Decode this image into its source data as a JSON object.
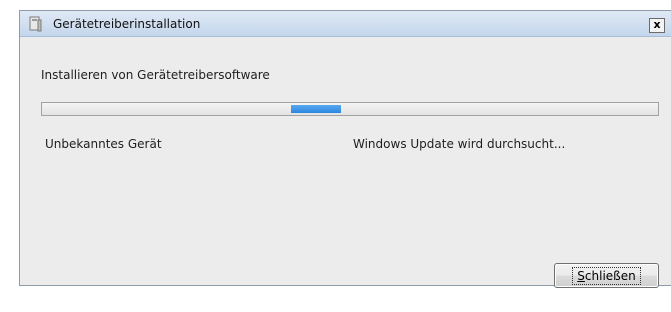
{
  "window": {
    "title": "Gerätetreiberinstallation",
    "close_glyph": "x",
    "heading": "Installieren von Gerätetreibersoftware",
    "progress": {
      "state": "marquee",
      "accent": "#2b86e0"
    },
    "device_name": "Unbekanntes Gerät",
    "status_text": "Windows Update wird durchsucht...",
    "close_button": {
      "accel": "S",
      "rest": "chließen"
    }
  }
}
